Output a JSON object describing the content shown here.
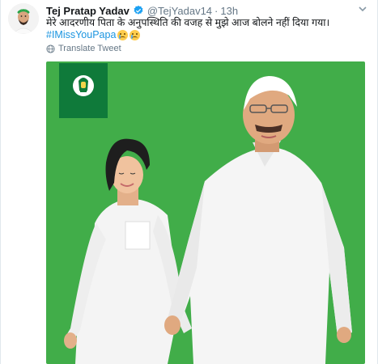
{
  "tweet": {
    "author_name": "Tej Pratap Yadav",
    "handle": "@TejYadav14",
    "separator": "·",
    "time": "13h",
    "text": "मेरे आदरणीय पिता के अनुपस्थिति की वजह से मुझे आज बोलने नहीं दिया गया।",
    "hashtag": "#IMissYouPapa",
    "translate_label": "Translate Tweet"
  },
  "colors": {
    "accent": "#1b95e0",
    "media_background": "#41ad49",
    "flag_green": "#0f7a3a",
    "muted": "#657786"
  },
  "icons": [
    "avatar",
    "verified-icon",
    "caret-down-icon",
    "globe-icon",
    "crying-emoji",
    "party-flag-emblem"
  ]
}
